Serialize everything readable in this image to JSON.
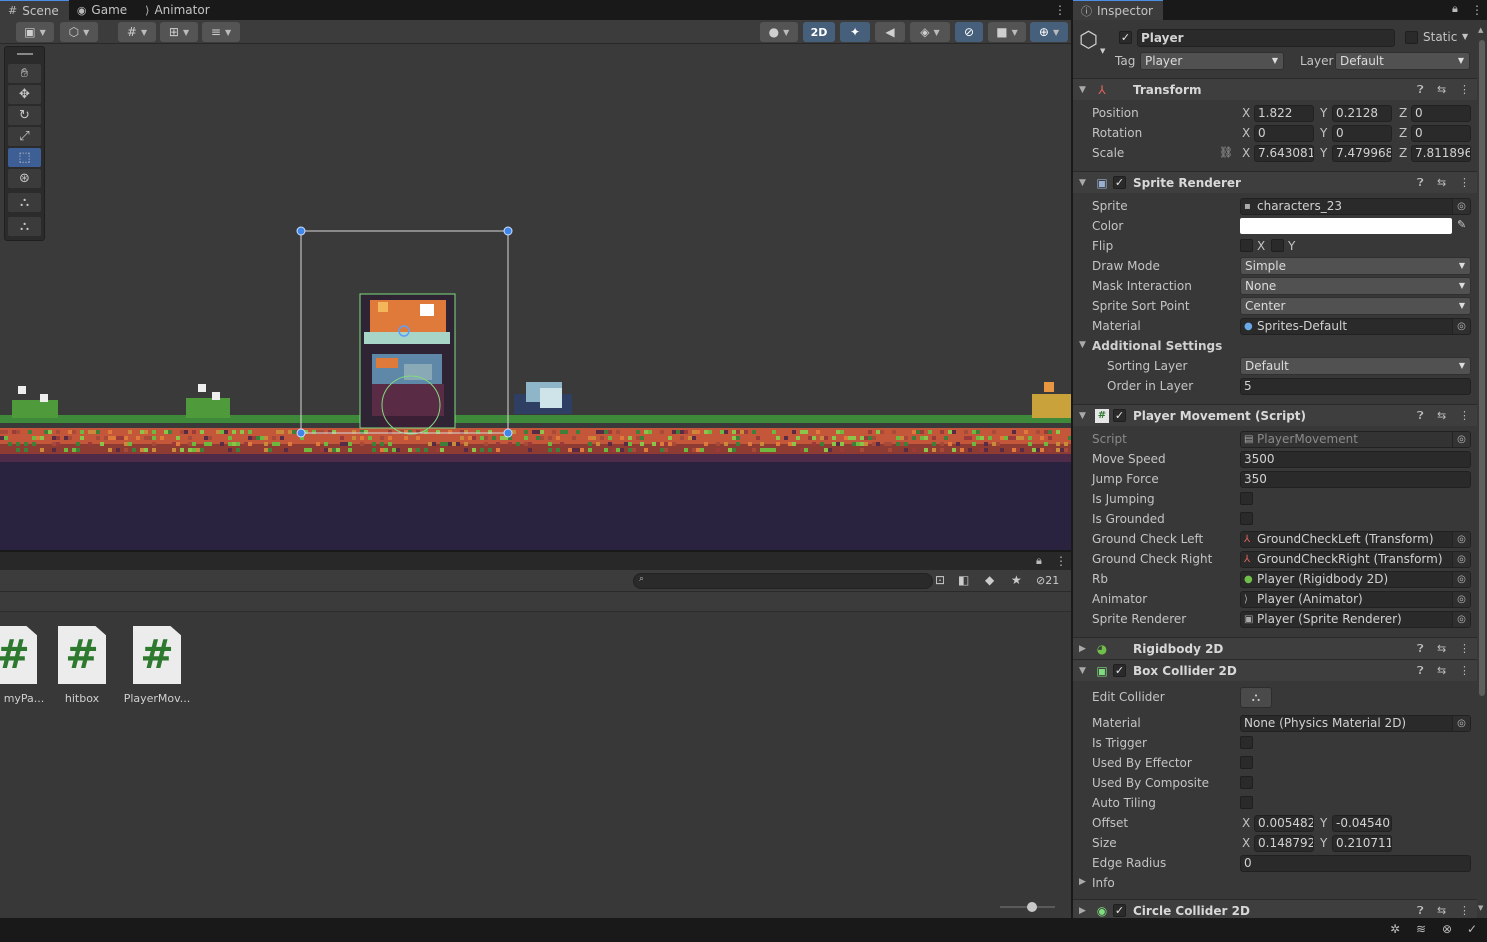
{
  "tabs": {
    "scene": "Scene",
    "game": "Game",
    "animator": "Animator",
    "inspector": "Inspector"
  },
  "scene_toolbar": {
    "mode_2d": "2D"
  },
  "project": {
    "badge_count": "21",
    "assets": [
      {
        "name": "EnemyPa...",
        "visible_label": "myPa..."
      },
      {
        "name": "hitbox",
        "visible_label": "hitbox"
      },
      {
        "name": "PlayerMov...",
        "visible_label": "PlayerMov..."
      }
    ],
    "asset_glyph": "#"
  },
  "inspector": {
    "object_name": "Player",
    "static_label": "Static",
    "tag_label": "Tag",
    "tag_value": "Player",
    "layer_label": "Layer",
    "layer_value": "Default",
    "transform": {
      "title": "Transform",
      "position_label": "Position",
      "rotation_label": "Rotation",
      "scale_label": "Scale",
      "position": {
        "x": "1.822",
        "y": "0.2128",
        "z": "0"
      },
      "rotation": {
        "x": "0",
        "y": "0",
        "z": "0"
      },
      "scale": {
        "x": "7.643081",
        "y": "7.479968",
        "z": "7.811896"
      }
    },
    "sprite_renderer": {
      "title": "Sprite Renderer",
      "sprite_label": "Sprite",
      "sprite_value": "characters_23",
      "color_label": "Color",
      "color_value": "#ffffff",
      "flip_label": "Flip",
      "flip_x": "X",
      "flip_y": "Y",
      "draw_mode_label": "Draw Mode",
      "draw_mode_value": "Simple",
      "mask_label": "Mask Interaction",
      "mask_value": "None",
      "sort_point_label": "Sprite Sort Point",
      "sort_point_value": "Center",
      "material_label": "Material",
      "material_value": "Sprites-Default",
      "additional_label": "Additional Settings",
      "sorting_layer_label": "Sorting Layer",
      "sorting_layer_value": "Default",
      "order_label": "Order in Layer",
      "order_value": "5"
    },
    "player_movement": {
      "title": "Player Movement (Script)",
      "script_label": "Script",
      "script_value": "PlayerMovement",
      "move_speed_label": "Move Speed",
      "move_speed_value": "3500",
      "jump_force_label": "Jump Force",
      "jump_force_value": "350",
      "is_jumping_label": "Is Jumping",
      "is_grounded_label": "Is Grounded",
      "gcl_label": "Ground Check Left",
      "gcl_value": "GroundCheckLeft (Transform)",
      "gcr_label": "Ground Check Right",
      "gcr_value": "GroundCheckRight (Transform)",
      "rb_label": "Rb",
      "rb_value": "Player (Rigidbody 2D)",
      "animator_label": "Animator",
      "animator_value": "Player (Animator)",
      "sr_label": "Sprite Renderer",
      "sr_value": "Player (Sprite Renderer)"
    },
    "rigidbody": {
      "title": "Rigidbody 2D"
    },
    "box_collider": {
      "title": "Box Collider 2D",
      "edit_label": "Edit Collider",
      "material_label": "Material",
      "material_value": "None (Physics Material 2D)",
      "trigger_label": "Is Trigger",
      "effector_label": "Used By Effector",
      "composite_label": "Used By Composite",
      "tiling_label": "Auto Tiling",
      "offset_label": "Offset",
      "offset": {
        "x": "0.005482",
        "y": "-0.04540"
      },
      "size_label": "Size",
      "size": {
        "x": "0.148792",
        "y": "0.210711"
      },
      "edge_label": "Edge Radius",
      "edge_value": "0",
      "info_label": "Info"
    },
    "circle_collider": {
      "title": "Circle Collider 2D"
    },
    "axis": {
      "x": "X",
      "y": "Y",
      "z": "Z"
    }
  },
  "colors": {
    "accent": "#4d8ee5",
    "selection_handle": "#3f86e8",
    "script_icon_green": "#2d7a2f"
  }
}
